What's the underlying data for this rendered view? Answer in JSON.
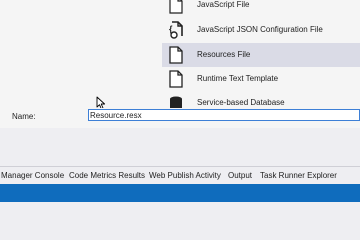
{
  "templates": {
    "items": [
      {
        "label": "JavaScript File",
        "icon": "javascript-file-icon"
      },
      {
        "label": "JavaScript JSON Configuration File",
        "icon": "json-config-file-icon"
      },
      {
        "label": "Resources File",
        "icon": "resources-file-icon",
        "selected": true
      },
      {
        "label": "Runtime Text Template",
        "icon": "text-template-icon"
      },
      {
        "label": "Service-based Database",
        "icon": "database-icon"
      }
    ]
  },
  "name_field": {
    "label": "Name:",
    "value": "Resource.resx"
  },
  "bottom_tabs": [
    {
      "label": "Manager Console"
    },
    {
      "label": "Code Metrics Results"
    },
    {
      "label": "Web Publish Activity"
    },
    {
      "label": "Output"
    },
    {
      "label": "Task Runner Explorer"
    }
  ],
  "colors": {
    "selected_row": "#dadbe6",
    "input_border": "#3d7fd6",
    "status_bar": "#0f6cbd"
  }
}
